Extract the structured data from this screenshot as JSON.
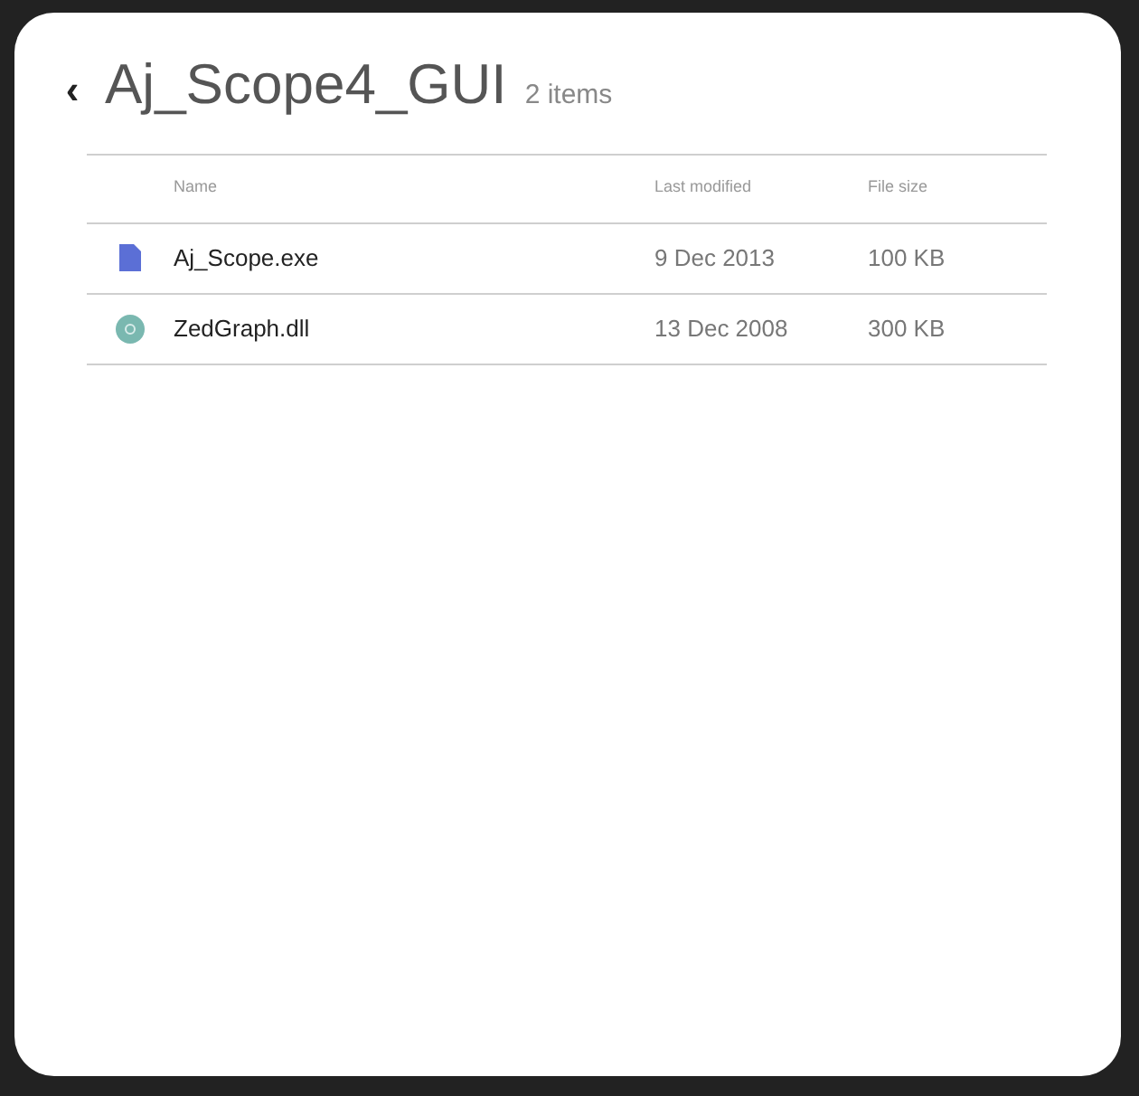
{
  "header": {
    "back": "‹",
    "title": "Aj_Scope4_GUI",
    "count": "2 items"
  },
  "table": {
    "columns": [
      "Name",
      "Last modified",
      "File size"
    ],
    "rows": [
      {
        "kind": "document",
        "name": "Aj_Scope.exe",
        "modified": "9 Dec 2013",
        "size": "100 KB"
      },
      {
        "kind": "disc",
        "name": "ZedGraph.dll",
        "modified": "13 Dec 2008",
        "size": "300 KB"
      }
    ]
  }
}
